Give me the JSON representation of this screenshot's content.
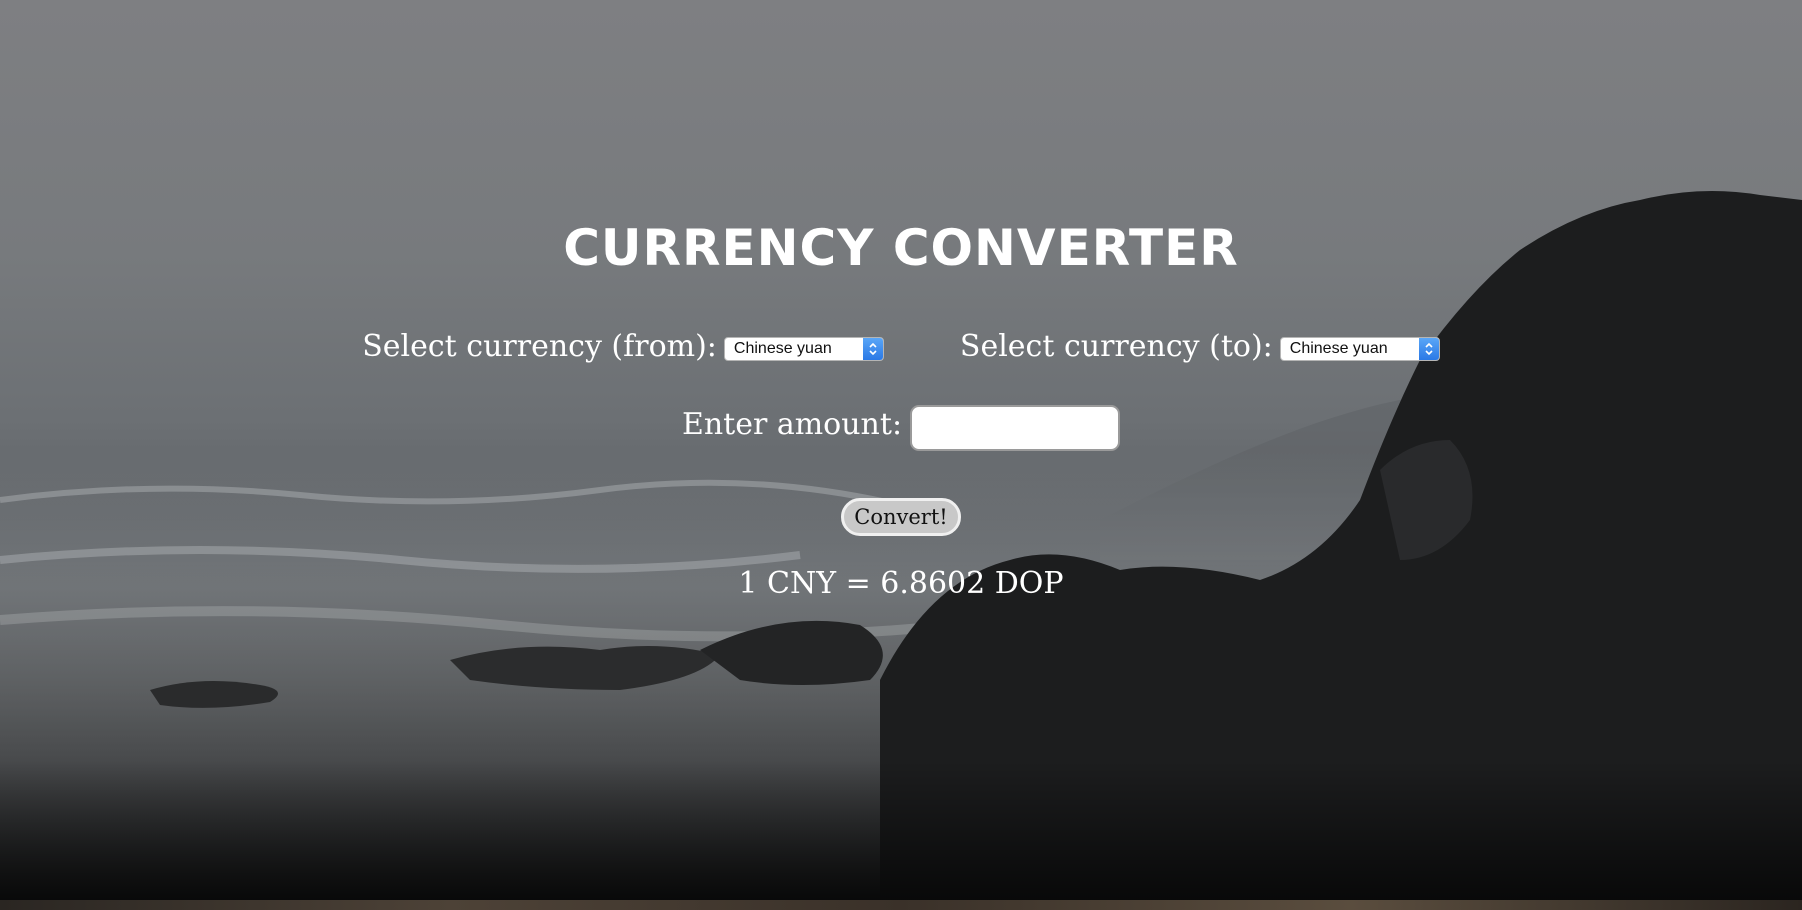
{
  "page": {
    "title": "CURRENCY CONVERTER"
  },
  "form": {
    "from_label": "Select currency (from):",
    "from_value": "Chinese yuan",
    "to_label": "Select currency (to):",
    "to_value": "Chinese yuan",
    "amount_label": "Enter amount:",
    "amount_value": "",
    "convert_label": "Convert!"
  },
  "result": {
    "text": "1 CNY = 6.8602 DOP"
  },
  "icons": {
    "select_arrow": "chevron-up-down-icon"
  },
  "colors": {
    "text": "#ffffff",
    "select_arrow": "#2a79e6",
    "button_bg": "#c8c8c8"
  }
}
